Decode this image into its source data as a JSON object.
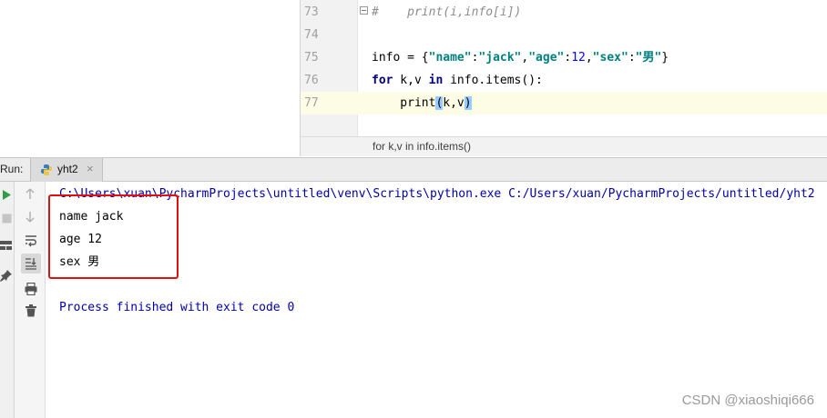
{
  "editor": {
    "line_numbers": [
      "73",
      "74",
      "75",
      "76",
      "77"
    ],
    "lines": {
      "l73": {
        "comment": "#    print(i,info[i])"
      },
      "l75": {
        "var": "info = {",
        "k1": "\"name\"",
        "colon1": ":",
        "v1": "\"jack\"",
        "comma1": ",",
        "k2": "\"age\"",
        "colon2": ":",
        "v2": "12",
        "comma2": ",",
        "k3": "\"sex\"",
        "colon3": ":",
        "v3": "\"男\"",
        "close": "}"
      },
      "l76": {
        "kw_for": "for",
        "mid": " k,v ",
        "kw_in": "in",
        "rest": " info.items():"
      },
      "l77": {
        "pre": "    print",
        "paren_open": "(",
        "args": "k,v",
        "paren_close": ")"
      }
    },
    "breadcrumb": "for k,v in info.items()"
  },
  "run_panel": {
    "label": "Run:",
    "tab_name": "yht2",
    "tab_close": "×"
  },
  "console": {
    "command": "C:\\Users\\xuan\\PycharmProjects\\untitled\\venv\\Scripts\\python.exe C:/Users/xuan/PycharmProjects/untitled/yht2",
    "output": [
      "name jack",
      "age 12",
      "sex 男"
    ],
    "exit_message": "Process finished with exit code 0"
  },
  "watermark": "CSDN @xiaoshiqi666",
  "colors": {
    "keyword": "#000080",
    "string": "#008080",
    "number": "#0000ff",
    "console_system": "#0000a8",
    "highlight_box": "#e01010",
    "run_green": "#2f9e44"
  },
  "icons": [
    "python-file-icon",
    "rerun-icon",
    "stop-icon",
    "layout-icon",
    "pin-icon",
    "up-arrow-icon",
    "down-arrow-icon",
    "soft-wrap-icon",
    "scroll-to-end-icon",
    "print-icon",
    "trash-icon"
  ]
}
